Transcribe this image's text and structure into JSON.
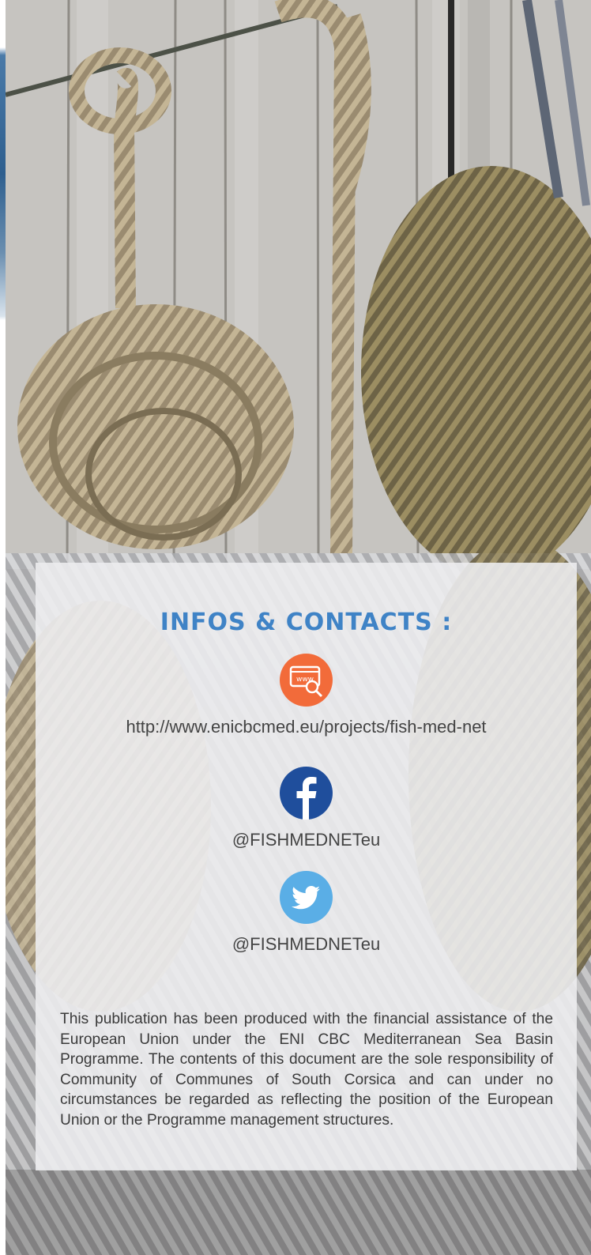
{
  "infos": {
    "title": "INFOS & CONTACTS :",
    "website": {
      "icon": "www-search-icon",
      "icon_color": "#f26b3a",
      "text": "http://www.enicbcmed.eu/projects/fish-med-net"
    },
    "facebook": {
      "icon": "facebook-icon",
      "icon_color": "#1f4e9c",
      "text": "@FISHMEDNETeu"
    },
    "twitter": {
      "icon": "twitter-icon",
      "icon_color": "#5aaee6",
      "text": "@FISHMEDNETeu"
    }
  },
  "disclaimer": "This publication has been produced with the financial assistance of the European Union under the ENI CBC Mediterranean Sea Basin Programme. The contents of this document are the sole responsibility of Community of Communes of South Corsica and can under no circumstances be regarded as reflecting the position of the European Union or the Programme management structures.",
  "colors": {
    "title": "#3f83c6",
    "card_background": "#ececee",
    "text": "#444444"
  }
}
